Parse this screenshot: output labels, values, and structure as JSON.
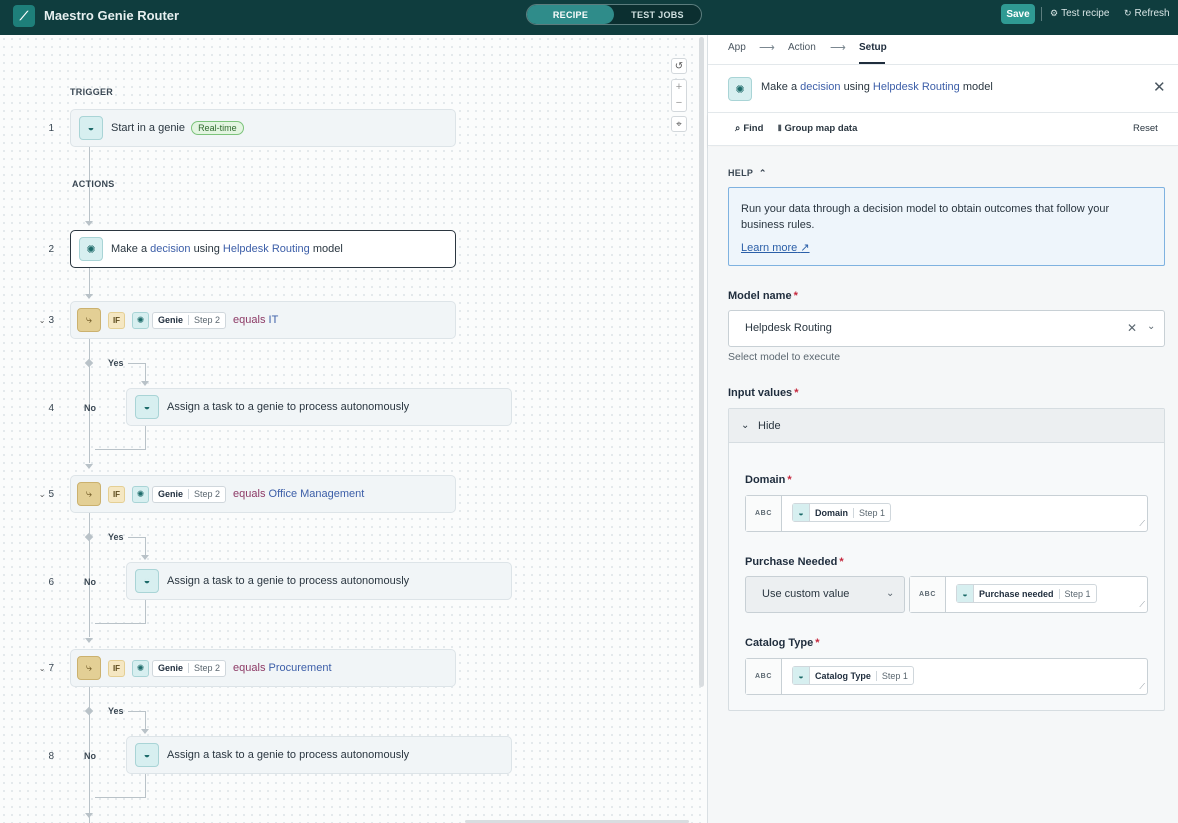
{
  "topbar": {
    "logo_glyph": "⟋",
    "title": "Maestro Genie Router",
    "tabs": [
      "RECIPE",
      "TEST JOBS"
    ],
    "save_label": "Save",
    "test_label": "Test recipe",
    "refresh_label": "Refresh",
    "brand_color": "#0f3d3e",
    "accent_color": "#2f9a93"
  },
  "canvas": {
    "trigger_label": "TRIGGER",
    "actions_label": "ACTIONS",
    "yes_label": "Yes",
    "no_label": "No",
    "step1": {
      "num": "1",
      "text": "Start in a genie",
      "badge": "Real-time"
    },
    "step2": {
      "num": "2",
      "pre": "Make a",
      "decision": "decision",
      "mid": "using",
      "model": "Helpdesk Routing",
      "post": "model"
    },
    "if_tag": "IF",
    "pill_name": "Genie",
    "pill_step": "Step 2",
    "equals": "equals",
    "assign_text": "Assign a task to a genie to process autonomously",
    "step3": {
      "num": "3",
      "value": "IT"
    },
    "step4": {
      "num": "4"
    },
    "step5": {
      "num": "5",
      "value": "Office Management"
    },
    "step6": {
      "num": "6"
    },
    "step7": {
      "num": "7",
      "value": "Procurement"
    },
    "step8": {
      "num": "8"
    },
    "zoom_plus": "+",
    "zoom_minus": "−"
  },
  "panel": {
    "crumbs": [
      "App",
      "Action",
      "Setup"
    ],
    "header": {
      "pre": "Make a",
      "decision": "decision",
      "mid": "using",
      "model": "Helpdesk Routing",
      "post": "model"
    },
    "find_label": "Find",
    "group_map_label": "Group map data",
    "reset_label": "Reset",
    "help_label": "HELP",
    "help_text": "Run your data through a decision model to obtain outcomes that follow your business rules.",
    "learn_more": "Learn more",
    "model_name_label": "Model name",
    "model_name_value": "Helpdesk Routing",
    "model_hint": "Select model to execute",
    "input_values_label": "Input values",
    "hide_label": "Hide",
    "abc": "ABC",
    "domain_label": "Domain",
    "domain_pill": {
      "name": "Domain",
      "step": "Step 1"
    },
    "purchase_label": "Purchase Needed",
    "purchase_select": "Use custom value",
    "purchase_pill": {
      "name": "Purchase needed",
      "step": "Step 1"
    },
    "catalog_label": "Catalog Type",
    "catalog_pill": {
      "name": "Catalog Type",
      "step": "Step 1"
    }
  }
}
